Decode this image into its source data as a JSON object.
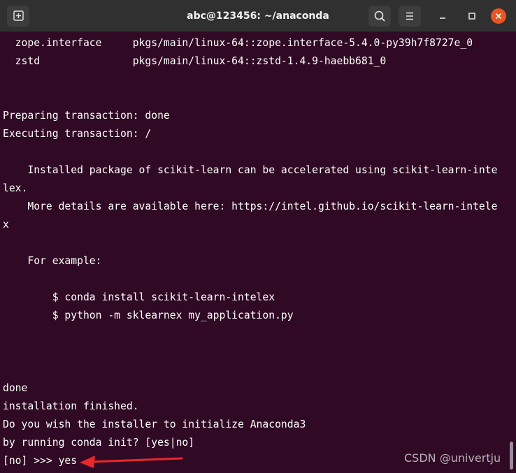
{
  "window": {
    "title": "abc@123456: ~/anaconda"
  },
  "icons": {
    "new_tab": "new-tab-icon",
    "search": "search-icon",
    "menu": "hamburger-menu-icon",
    "minimize": "minimize-icon",
    "maximize": "maximize-icon",
    "close": "close-icon"
  },
  "colors": {
    "terminal_bg": "#300a24",
    "titlebar_bg": "#303030",
    "close_button": "#e95420",
    "arrow": "#e8282a"
  },
  "terminal": {
    "lines": [
      "  zope.interface     pkgs/main/linux-64::zope.interface-5.4.0-py39h7f8727e_0",
      "  zstd               pkgs/main/linux-64::zstd-1.4.9-haebb681_0",
      "",
      "",
      "Preparing transaction: done",
      "Executing transaction: /",
      "",
      "    Installed package of scikit-learn can be accelerated using scikit-learn-inte",
      "lex.",
      "    More details are available here: https://intel.github.io/scikit-learn-intele",
      "x",
      "",
      "    For example:",
      "",
      "        $ conda install scikit-learn-intelex",
      "        $ python -m sklearnex my_application.py",
      "",
      "",
      "",
      "done",
      "installation finished.",
      "Do you wish the installer to initialize Anaconda3",
      "by running conda init? [yes|no]",
      "[no] >>> yes"
    ]
  },
  "watermark": "CSDN @univertju"
}
